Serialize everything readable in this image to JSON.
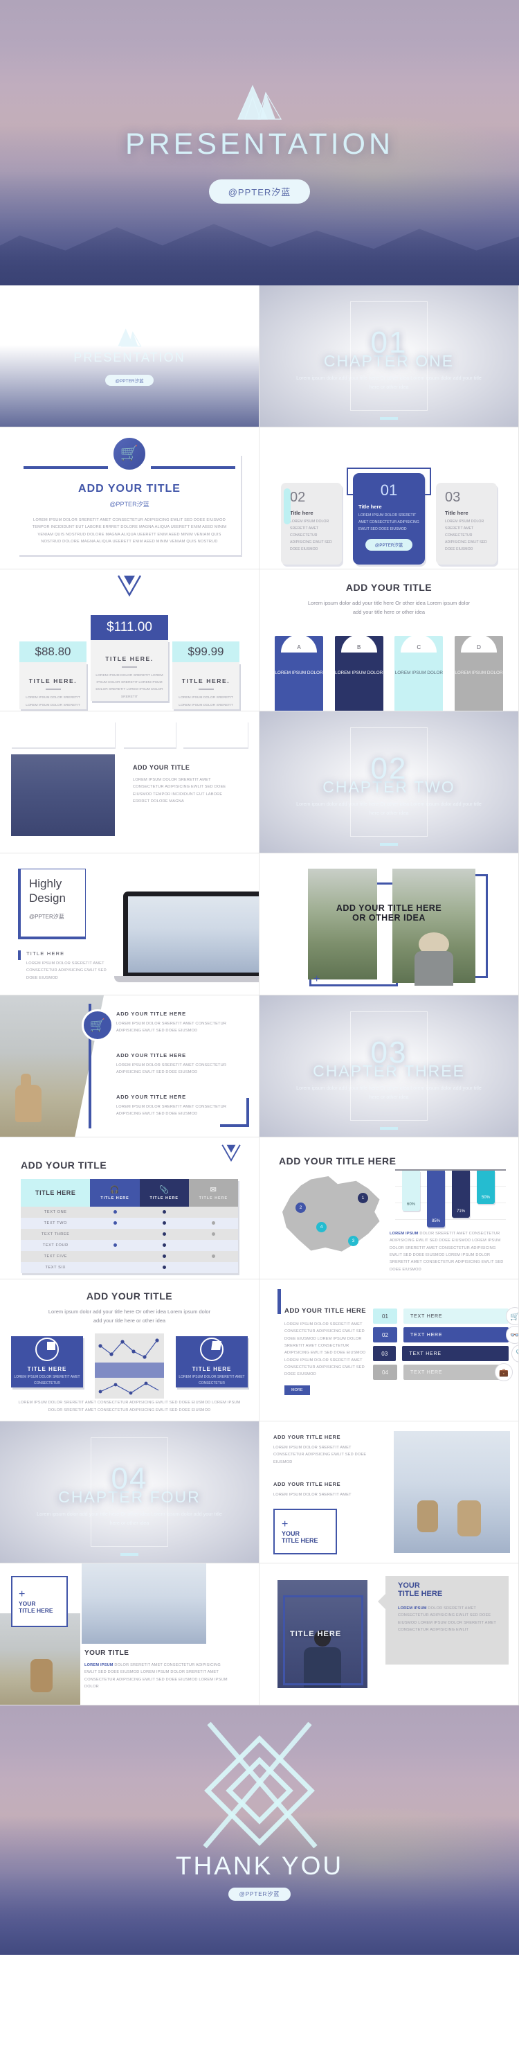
{
  "hero": {
    "title": "PRESENTATION",
    "badge": "@PPTER汐蓝",
    "logo_icon": "mountain-logo-icon"
  },
  "slides": {
    "title_slide": {
      "title": "PRESENTATION",
      "badge": "@PPTER汐蓝"
    },
    "chapter_one": {
      "number": "01",
      "name": "CHAPTER ONE",
      "desc": "Lorem ipsum dolor add your title here Or other idea Lorem ipsum dolor add your title here or other idea"
    },
    "chapter_two": {
      "number": "02",
      "name": "CHAPTER TWO",
      "desc": "Lorem ipsum dolor add your title here Or other idea Lorem ipsum dolor add your title here or other idea"
    },
    "chapter_three": {
      "number": "03",
      "name": "CHAPTER THREE",
      "desc": "Lorem ipsum dolor add your title here Or other idea Lorem ipsum dolor add your title here or other idea"
    },
    "chapter_four": {
      "number": "04",
      "name": "CHAPTER FOUR",
      "desc": "Lorem ipsum dolor add your title here Or other idea Lorem ipsum dolor add your title here or other idea"
    },
    "add_title_card": {
      "icon": "shopping-cart-icon",
      "title": "ADD YOUR TITLE",
      "handle": "@PPTER汐蓝",
      "body": "LOREM IPSUM DOLOR SRERETIT AMET CONSECTETUR ADIPISICING EWLIT SED DOEE EIUSMOD TEMPOR INCIDIDUNT EUT LABORE ERRRET DOLORE MAGNA ALIQUA UEERETT ENIM AEED MINIM VENIAM QUIS NOSTRUD DOLORE MAGNA ALIQUA UEERETT ENIM AEED MINIM VENIAM QUIS NOSTRUD DOLORE MAGNA ALIQUA UEERETT ENIM AEED MINIM VENIAM QUIS NOSTRUD"
    },
    "three_cards": {
      "badge": "@PPTER汐蓝",
      "items": [
        {
          "num": "02",
          "title": "Title here",
          "body": "LOREM IPSUM DOLOR SRERETIT AMET CONSECTETUR ADIPISICING EWLIT SED DOEE EIUSMOD"
        },
        {
          "num": "01",
          "title": "Title here",
          "body": "LOREM IPSUM DOLOR SRERETIT AMET CONSECTETUR ADIPISICING EWLIT SED DOEE EIUSMOD"
        },
        {
          "num": "03",
          "title": "Title here",
          "body": "LOREM IPSUM DOLOR SRERETIT AMET CONSECTETUR ADIPISICING EWLIT SED DOEE EIUSMOD"
        }
      ]
    },
    "pricing": {
      "items": [
        {
          "price": "$88.80",
          "title": "TITLE HERE.",
          "body": "LOREM IPSUM DOLOR SRERETIT LOREM IPSUM DOLOR SRERETIT"
        },
        {
          "price": "$111.00",
          "title": "TITLE HERE.",
          "body": "LOREM IPSUM DOLOR SRERETIT LOREM IPSUM DOLOR SRERETIT LOREM IPSUM DOLOR SRERETIT LOREM IPSUM DOLOR SRERETIT"
        },
        {
          "price": "$99.99",
          "title": "TITLE HERE.",
          "body": "LOREM IPSUM DOLOR SRERETIT LOREM IPSUM DOLOR SRERETIT"
        }
      ]
    },
    "abcd": {
      "title": "ADD YOUR TITLE",
      "subtitle": "Lorem ipsum dolor add your title here Or other idea Lorem ipsum dolor add your title here or other idea",
      "items": [
        {
          "letter": "A",
          "text": "LOREM IPSUM DOLOR",
          "color": "#4155a8"
        },
        {
          "letter": "B",
          "text": "LOREM IPSUM DOLOR",
          "color": "#2b3468"
        },
        {
          "letter": "C",
          "text": "LOREM IPSUM DOLOR",
          "color": "#c7f2f4"
        },
        {
          "letter": "D",
          "text": "LOREM IPSUM DOLOR",
          "color": "#b0b0b0"
        }
      ]
    },
    "photo_text": {
      "title": "ADD YOUR TITLE",
      "body": "LOREM IPSUM DOLOR SRERETIT AMET CONSECTETUR ADIPISICING EWLIT SED DOEE EIUSMOD TEMPOR INCIDIDUNT EUT LABORE ERRRET DOLORE MAGNA"
    },
    "highly_design": {
      "title_line1": "Highly",
      "title_line2": "Design",
      "handle": "@PPTER汐蓝",
      "sub_title": "TITLE HERE",
      "body": "LOREM IPSUM DOLOR SRERETIT AMET CONSECTETUR ADIPISICING EWLIT SED DOEE EIUSMOD"
    },
    "two_photo": {
      "title_line1": "ADD YOUR TITLE HERE",
      "title_line2": "OR OTHER IDEA",
      "plus_icon": "plus-icon"
    },
    "deer_slide": {
      "icon": "shopping-cart-icon",
      "heading1": "ADD YOUR TITLE HERE",
      "body1": "LOREM IPSUM DOLOR SRERETIT AMET CONSECTETUR ADIPISICING EWLIT SED DOEE EIUSMOD",
      "heading2": "ADD YOUR TITLE HERE",
      "body2": "LOREM IPSUM DOLOR SRERETIT AMET CONSECTETUR ADIPISICING EWLIT SED DOEE EIUSMOD",
      "heading3": "ADD YOUR TITLE HERE",
      "body3": "LOREM IPSUM DOLOR SRERETIT AMET CONSECTETUR ADIPISICING EWLIT SED DOEE EIUSMOD"
    },
    "table_slide": {
      "title": "ADD YOUR TITLE",
      "corner_col": "TITLE HERE",
      "columns": [
        {
          "icon": "headphones-icon",
          "label": "TITLE HERE",
          "style": "th1"
        },
        {
          "icon": "paperclip-icon",
          "label": "TITLE HERE",
          "style": "th2"
        },
        {
          "icon": "envelope-icon",
          "label": "TITLE HERE",
          "style": "th3"
        }
      ],
      "rows": [
        {
          "label": "TEXT   ONE",
          "marks": [
            true,
            true,
            false
          ]
        },
        {
          "label": "TEXT   TWO",
          "marks": [
            true,
            true,
            true
          ]
        },
        {
          "label": "TEXT THREE",
          "marks": [
            false,
            true,
            true
          ]
        },
        {
          "label": "TEXT  FOUR",
          "marks": [
            true,
            true,
            false
          ]
        },
        {
          "label": "TEXT   FIVE",
          "marks": [
            false,
            true,
            true
          ]
        },
        {
          "label": "TEXT    SIX",
          "marks": [
            false,
            true,
            false
          ]
        }
      ]
    },
    "map_slide": {
      "title": "ADD YOUR TITLE HERE",
      "pins": [
        "1",
        "2",
        "3",
        "4"
      ],
      "caption_strong": "LOREM IPSUM",
      "caption": " DOLOR SRERETIT AMET CONSECTETUR ADIPISICING EWLIT SED DOEE EIUSMOD LOREM IPSUM DOLOR SRERETIT AMET CONSECTETUR ADIPISICING EWLIT SED DOEE EIUSMOD LOREM IPSUM DOLOR SRERETIT AMET CONSECTETUR ADIPISICING EWLIT SED DOEE EIUSMOD"
    },
    "charts_slide": {
      "title": "ADD YOUR TITLE",
      "subtitle": "Lorem ipsum dolor add your title here Or other idea Lorem ipsum dolor add your title here or other idea",
      "card_left": {
        "title": "TITLE HERE",
        "body": "LOREM IPSUM DOLOR SRERETIT AMET CONSECTETUR"
      },
      "card_right": {
        "title": "TITLE HERE",
        "body": "LOREM IPSUM DOLOR SRERETIT AMET CONSECTETUR"
      },
      "footer": "LOREM IPSUM DOLOR SRERETIT AMET CONSECTETUR ADIPISICING EWLIT SED DOEE EIUSMOD LOREM IPSUM DOLOR SRERETIT AMET CONSECTETUR ADIPISICING EWLIT SED DOEE EIUSMOD"
    },
    "list_slide": {
      "title": "ADD YOUR TITLE HERE",
      "body": "LOREM IPSUM DOLOR SRERETIT AMET CONSECTETUR ADIPISICING EWLIT SED DOEE EIUSMOD LOREM IPSUM DOLOR SRERETIT AMET CONSECTETUR ADIPISICING EWLIT SED DOEE EIUSMOD LOREM IPSUM DOLOR SRERETIT AMET CONSECTETUR ADIPISICING EWLIT SED DOEE EIUSMOD",
      "rows": [
        {
          "num": "01",
          "text": "TEXT HERE",
          "icon": "shopping-cart-icon",
          "bg": "#c7f2f4",
          "fg": "#44444f",
          "w": 152
        },
        {
          "num": "02",
          "text": "TEXT HERE",
          "icon": "binoculars-icon",
          "bg": "#4155a8",
          "fg": "#ffffff",
          "w": 168
        },
        {
          "num": "03",
          "text": "TEXT HERE",
          "icon": "paperclip-icon",
          "bg": "#2b3468",
          "fg": "#ffffff",
          "w": 184
        },
        {
          "num": "04",
          "text": "TEXT HERE",
          "icon": "briefcase-icon",
          "bg": "#b0b0b0",
          "fg": "#efefef",
          "w": 140
        }
      ]
    },
    "deer_right": {
      "heading1": "ADD YOUR TITLE HERE",
      "body1": "LOREM IPSUM DOLOR SRERETIT AMET CONSECTETUR ADIPISICING EWLIT SED DOEE EIUSMOD",
      "heading2": "ADD YOUR TITLE HERE",
      "body2": "LOREM IPSUM DOLOR SRERETIT AMET",
      "frame_title_line1": "YOUR",
      "frame_title_line2": "TITLE HERE",
      "plus_icon": "plus-icon"
    },
    "your_title_left": {
      "line1": "YOUR",
      "line2": "TITLE HERE",
      "plus_icon": "plus-icon"
    },
    "your_title_mid": {
      "title": "YOUR TITLE",
      "strong": "LOREM IPSUM",
      "body": " DOLOR SRERETIT AMET CONSECTETUR ADIPISICING EWLIT SED DOEE EIUSMOD LOREM IPSUM DOLOR SRERETIT AMET CONSECTETUR ADIPISICING EWLIT SED DOEE EIUSMOD LOREM IPSUM DOLOR"
    },
    "your_title_overlay": {
      "title": "TITLE HERE"
    },
    "your_title_right": {
      "line1": "YOUR",
      "line2": "TITLE HERE",
      "strong": "LOREM IPSUM",
      "body": " DOLOR SRERETIT AMET CONSECTETUR ADIPISICING EWLIT SED DOEE EIUSMOD LOREM IPSUM DOLOR SRERETIT AMET CONSECTETUR ADIPISICING EWLIT"
    }
  },
  "thanks": {
    "title": "THANK YOU",
    "badge": "@PPTER汐蓝",
    "logo_icon": "diamond-logo-icon"
  },
  "colors": {
    "primary": "#4155a8",
    "dark": "#2b3468",
    "cyan": "#c7f2f4",
    "gray": "#b0b0b0",
    "teal": "#25bcd0"
  },
  "chart_data": [
    {
      "type": "bar",
      "title": "ADD YOUR TITLE HERE",
      "orientation": "hanging",
      "categories": [
        "1",
        "2",
        "3",
        "4"
      ],
      "values": [
        60,
        85,
        71,
        50
      ],
      "labels": [
        "60%",
        "85%",
        "71%",
        "50%"
      ],
      "colors": [
        "#d6f4f6",
        "#4155a8",
        "#2b3468",
        "#25bcd0"
      ],
      "ylim": [
        0,
        100
      ],
      "ylabel": "",
      "xlabel": "",
      "grid": true,
      "legend": "none"
    },
    {
      "type": "pie",
      "title": "TITLE HERE",
      "categories": [
        "segment-a",
        "segment-b"
      ],
      "values": [
        25,
        75
      ],
      "colors": [
        "#ffffff",
        "#3f51a4"
      ]
    },
    {
      "type": "pie",
      "title": "TITLE HERE",
      "categories": [
        "segment-a",
        "segment-b"
      ],
      "values": [
        30,
        70
      ],
      "colors": [
        "#ffffff",
        "#3f51a4"
      ]
    },
    {
      "type": "line",
      "title": "",
      "x": [
        1,
        2,
        3,
        4,
        5,
        6
      ],
      "values": [
        52,
        28,
        70,
        45,
        22,
        72
      ],
      "ylim": [
        0,
        100
      ],
      "grid": false,
      "legend": "none"
    }
  ]
}
